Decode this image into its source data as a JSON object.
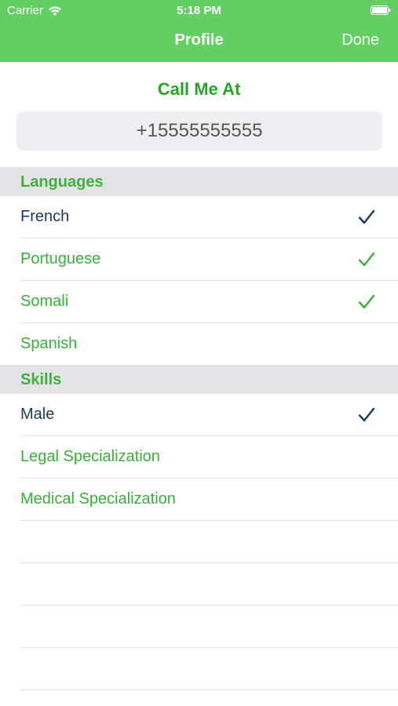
{
  "status_bar": {
    "carrier": "Carrier",
    "time": "5:18 PM"
  },
  "nav": {
    "title": "Profile",
    "done_label": "Done"
  },
  "call": {
    "title": "Call Me At",
    "phone_value": "+15555555555"
  },
  "languages": {
    "header": "Languages",
    "items": [
      {
        "label": "French",
        "checked": true,
        "style": "dark"
      },
      {
        "label": "Portuguese",
        "checked": true,
        "style": "green"
      },
      {
        "label": "Somali",
        "checked": true,
        "style": "green"
      },
      {
        "label": "Spanish",
        "checked": false,
        "style": "green"
      }
    ]
  },
  "skills": {
    "header": "Skills",
    "items": [
      {
        "label": "Male",
        "checked": true,
        "style": "dark"
      },
      {
        "label": "Legal Specialization",
        "checked": false,
        "style": "green"
      },
      {
        "label": "Medical Specialization",
        "checked": false,
        "style": "green"
      }
    ]
  },
  "colors": {
    "header_bg": "#63cf63",
    "accent_green": "#24a824",
    "dark_text": "#1b3a57",
    "section_bg": "#e4e4e6"
  },
  "icons": {
    "wifi": "wifi-icon",
    "battery": "battery-icon",
    "check": "checkmark-icon"
  }
}
